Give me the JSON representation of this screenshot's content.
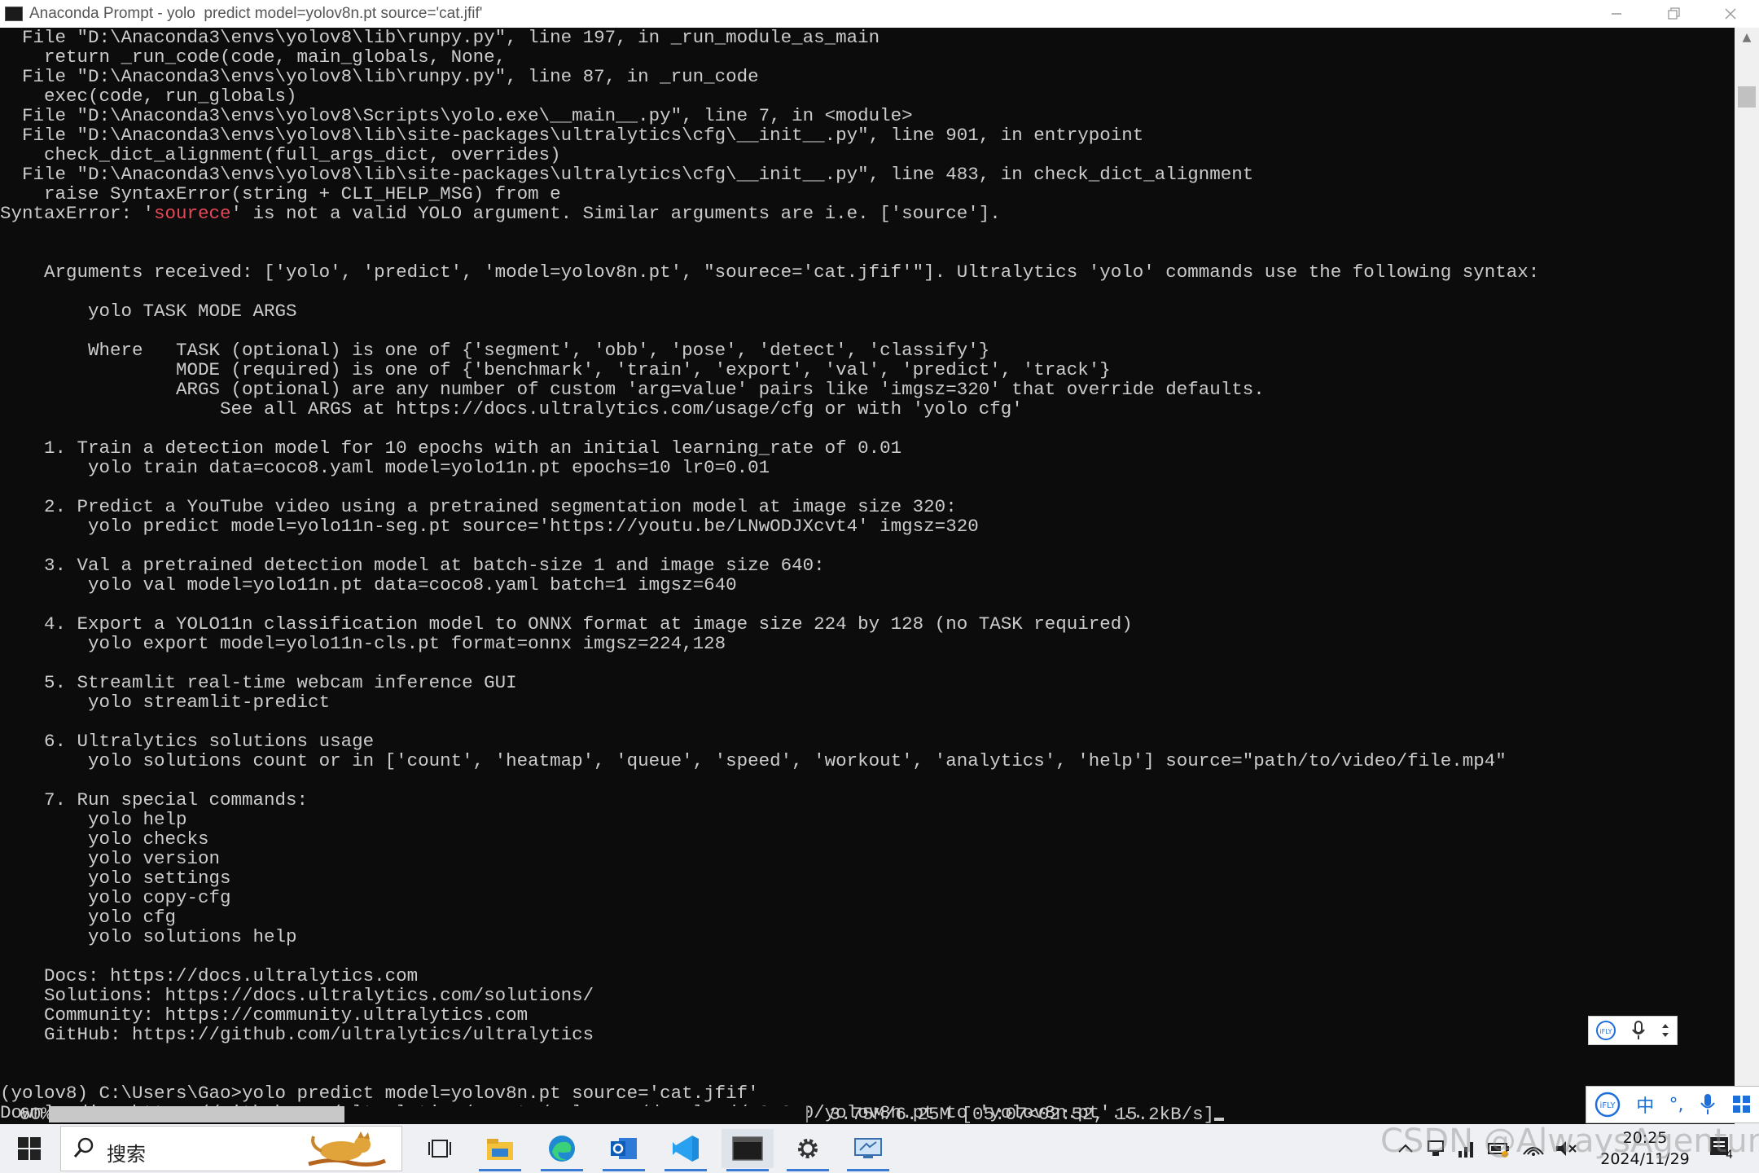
{
  "window": {
    "title": "Anaconda Prompt - yolo  predict model=yolov8n.pt source='cat.jfif'",
    "minimize_icon": "minimize-icon",
    "restore_icon": "restore-icon",
    "close_icon": "close-icon"
  },
  "console": {
    "lines": [
      "  File \"D:\\Anaconda3\\envs\\yolov8\\lib\\runpy.py\", line 197, in _run_module_as_main",
      "    return _run_code(code, main_globals, None,",
      "  File \"D:\\Anaconda3\\envs\\yolov8\\lib\\runpy.py\", line 87, in _run_code",
      "    exec(code, run_globals)",
      "  File \"D:\\Anaconda3\\envs\\yolov8\\Scripts\\yolo.exe\\__main__.py\", line 7, in <module>",
      "  File \"D:\\Anaconda3\\envs\\yolov8\\lib\\site-packages\\ultralytics\\cfg\\__init__.py\", line 901, in entrypoint",
      "    check_dict_alignment(full_args_dict, overrides)",
      "  File \"D:\\Anaconda3\\envs\\yolov8\\lib\\site-packages\\ultralytics\\cfg\\__init__.py\", line 483, in check_dict_alignment",
      "    raise SyntaxError(string + CLI_HELP_MSG) from e",
      "",
      "",
      "    Arguments received: ['yolo', 'predict', 'model=yolov8n.pt', \"sourece='cat.jfif'\"]. Ultralytics 'yolo' commands use the following syntax:",
      "",
      "        yolo TASK MODE ARGS",
      "",
      "        Where   TASK (optional) is one of {'segment', 'obb', 'pose', 'detect', 'classify'}",
      "                MODE (required) is one of {'benchmark', 'train', 'export', 'val', 'predict', 'track'}",
      "                ARGS (optional) are any number of custom 'arg=value' pairs like 'imgsz=320' that override defaults.",
      "                    See all ARGS at https://docs.ultralytics.com/usage/cfg or with 'yolo cfg'",
      "",
      "    1. Train a detection model for 10 epochs with an initial learning_rate of 0.01",
      "        yolo train data=coco8.yaml model=yolo11n.pt epochs=10 lr0=0.01",
      "",
      "    2. Predict a YouTube video using a pretrained segmentation model at image size 320:",
      "        yolo predict model=yolo11n-seg.pt source='https://youtu.be/LNwODJXcvt4' imgsz=320",
      "",
      "    3. Val a pretrained detection model at batch-size 1 and image size 640:",
      "        yolo val model=yolo11n.pt data=coco8.yaml batch=1 imgsz=640",
      "",
      "    4. Export a YOLO11n classification model to ONNX format at image size 224 by 128 (no TASK required)",
      "        yolo export model=yolo11n-cls.pt format=onnx imgsz=224,128",
      "",
      "    5. Streamlit real-time webcam inference GUI",
      "        yolo streamlit-predict",
      "",
      "    6. Ultralytics solutions usage",
      "        yolo solutions count or in ['count', 'heatmap', 'queue', 'speed', 'workout', 'analytics', 'help'] source=\"path/to/video/file.mp4\"",
      "",
      "    7. Run special commands:",
      "        yolo help",
      "        yolo checks",
      "        yolo version",
      "        yolo settings",
      "        yolo copy-cfg",
      "        yolo cfg",
      "        yolo solutions help",
      "",
      "    Docs: https://docs.ultralytics.com",
      "    Solutions: https://docs.ultralytics.com/solutions/",
      "    Community: https://community.ultralytics.com",
      "    GitHub: https://github.com/ultralytics/ultralytics",
      "",
      "",
      "(yolov8) C:\\Users\\Gao>yolo predict model=yolov8n.pt source='cat.jfif'",
      "Downloading https://github.com/ultralytics/assets/releases/download/v8.3.0/yolov8n.pt to 'yolov8n.pt'..."
    ],
    "syntax_error": {
      "prefix": "SyntaxError: '",
      "highlight": "sourece",
      "suffix": "' is not a valid YOLO argument. Similar arguments are i.e. ['source']."
    },
    "syntax_error_line_index": 9,
    "error_color": "#e74856",
    "text_color": "#cccccc",
    "background_color": "#0c0c0c"
  },
  "download": {
    "percent_label": " 60%",
    "progress_fraction": 0.6,
    "stats": " 3.75M/6.25M [05:07<02:52, 15.2kB/s]"
  },
  "ime": {
    "mini_icons": [
      "ifly-logo-icon",
      "microphone-icon",
      "more-icon"
    ],
    "bar_items": [
      "ifly-logo-icon",
      "中",
      "°,",
      "microphone-icon",
      "grid-icon"
    ]
  },
  "taskbar": {
    "search_placeholder": "搜索",
    "apps": [
      {
        "name": "task-view-icon"
      },
      {
        "name": "file-explorer-icon"
      },
      {
        "name": "edge-browser-icon"
      },
      {
        "name": "outlook-icon"
      },
      {
        "name": "vscode-icon"
      },
      {
        "name": "terminal-icon"
      },
      {
        "name": "settings-gear-icon"
      },
      {
        "name": "remote-desktop-icon"
      }
    ],
    "tray_icons": [
      "chevron-up-icon",
      "usb-icon",
      "network-bars-icon",
      "battery-icon",
      "wifi-icon",
      "volume-muted-icon"
    ],
    "time": "20:25",
    "date": "2024/11/29",
    "notification_count": "4"
  },
  "watermark": "CSDN @AlwaysAgentum",
  "accent_color": "#3a7bd5"
}
